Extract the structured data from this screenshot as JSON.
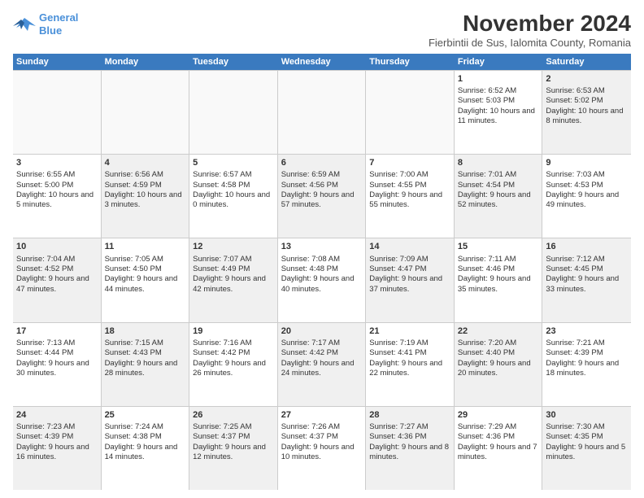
{
  "logo": {
    "line1": "General",
    "line2": "Blue"
  },
  "header": {
    "title": "November 2024",
    "subtitle": "Fierbintii de Sus, Ialomita County, Romania"
  },
  "weekdays": [
    "Sunday",
    "Monday",
    "Tuesday",
    "Wednesday",
    "Thursday",
    "Friday",
    "Saturday"
  ],
  "rows": [
    [
      {
        "day": "",
        "sunrise": "",
        "sunset": "",
        "daylight": "",
        "shaded": false,
        "empty": true
      },
      {
        "day": "",
        "sunrise": "",
        "sunset": "",
        "daylight": "",
        "shaded": false,
        "empty": true
      },
      {
        "day": "",
        "sunrise": "",
        "sunset": "",
        "daylight": "",
        "shaded": false,
        "empty": true
      },
      {
        "day": "",
        "sunrise": "",
        "sunset": "",
        "daylight": "",
        "shaded": false,
        "empty": true
      },
      {
        "day": "",
        "sunrise": "",
        "sunset": "",
        "daylight": "",
        "shaded": false,
        "empty": true
      },
      {
        "day": "1",
        "sunrise": "Sunrise: 6:52 AM",
        "sunset": "Sunset: 5:03 PM",
        "daylight": "Daylight: 10 hours and 11 minutes.",
        "shaded": false,
        "empty": false
      },
      {
        "day": "2",
        "sunrise": "Sunrise: 6:53 AM",
        "sunset": "Sunset: 5:02 PM",
        "daylight": "Daylight: 10 hours and 8 minutes.",
        "shaded": true,
        "empty": false
      }
    ],
    [
      {
        "day": "3",
        "sunrise": "Sunrise: 6:55 AM",
        "sunset": "Sunset: 5:00 PM",
        "daylight": "Daylight: 10 hours and 5 minutes.",
        "shaded": false,
        "empty": false
      },
      {
        "day": "4",
        "sunrise": "Sunrise: 6:56 AM",
        "sunset": "Sunset: 4:59 PM",
        "daylight": "Daylight: 10 hours and 3 minutes.",
        "shaded": true,
        "empty": false
      },
      {
        "day": "5",
        "sunrise": "Sunrise: 6:57 AM",
        "sunset": "Sunset: 4:58 PM",
        "daylight": "Daylight: 10 hours and 0 minutes.",
        "shaded": false,
        "empty": false
      },
      {
        "day": "6",
        "sunrise": "Sunrise: 6:59 AM",
        "sunset": "Sunset: 4:56 PM",
        "daylight": "Daylight: 9 hours and 57 minutes.",
        "shaded": true,
        "empty": false
      },
      {
        "day": "7",
        "sunrise": "Sunrise: 7:00 AM",
        "sunset": "Sunset: 4:55 PM",
        "daylight": "Daylight: 9 hours and 55 minutes.",
        "shaded": false,
        "empty": false
      },
      {
        "day": "8",
        "sunrise": "Sunrise: 7:01 AM",
        "sunset": "Sunset: 4:54 PM",
        "daylight": "Daylight: 9 hours and 52 minutes.",
        "shaded": true,
        "empty": false
      },
      {
        "day": "9",
        "sunrise": "Sunrise: 7:03 AM",
        "sunset": "Sunset: 4:53 PM",
        "daylight": "Daylight: 9 hours and 49 minutes.",
        "shaded": false,
        "empty": false
      }
    ],
    [
      {
        "day": "10",
        "sunrise": "Sunrise: 7:04 AM",
        "sunset": "Sunset: 4:52 PM",
        "daylight": "Daylight: 9 hours and 47 minutes.",
        "shaded": true,
        "empty": false
      },
      {
        "day": "11",
        "sunrise": "Sunrise: 7:05 AM",
        "sunset": "Sunset: 4:50 PM",
        "daylight": "Daylight: 9 hours and 44 minutes.",
        "shaded": false,
        "empty": false
      },
      {
        "day": "12",
        "sunrise": "Sunrise: 7:07 AM",
        "sunset": "Sunset: 4:49 PM",
        "daylight": "Daylight: 9 hours and 42 minutes.",
        "shaded": true,
        "empty": false
      },
      {
        "day": "13",
        "sunrise": "Sunrise: 7:08 AM",
        "sunset": "Sunset: 4:48 PM",
        "daylight": "Daylight: 9 hours and 40 minutes.",
        "shaded": false,
        "empty": false
      },
      {
        "day": "14",
        "sunrise": "Sunrise: 7:09 AM",
        "sunset": "Sunset: 4:47 PM",
        "daylight": "Daylight: 9 hours and 37 minutes.",
        "shaded": true,
        "empty": false
      },
      {
        "day": "15",
        "sunrise": "Sunrise: 7:11 AM",
        "sunset": "Sunset: 4:46 PM",
        "daylight": "Daylight: 9 hours and 35 minutes.",
        "shaded": false,
        "empty": false
      },
      {
        "day": "16",
        "sunrise": "Sunrise: 7:12 AM",
        "sunset": "Sunset: 4:45 PM",
        "daylight": "Daylight: 9 hours and 33 minutes.",
        "shaded": true,
        "empty": false
      }
    ],
    [
      {
        "day": "17",
        "sunrise": "Sunrise: 7:13 AM",
        "sunset": "Sunset: 4:44 PM",
        "daylight": "Daylight: 9 hours and 30 minutes.",
        "shaded": false,
        "empty": false
      },
      {
        "day": "18",
        "sunrise": "Sunrise: 7:15 AM",
        "sunset": "Sunset: 4:43 PM",
        "daylight": "Daylight: 9 hours and 28 minutes.",
        "shaded": true,
        "empty": false
      },
      {
        "day": "19",
        "sunrise": "Sunrise: 7:16 AM",
        "sunset": "Sunset: 4:42 PM",
        "daylight": "Daylight: 9 hours and 26 minutes.",
        "shaded": false,
        "empty": false
      },
      {
        "day": "20",
        "sunrise": "Sunrise: 7:17 AM",
        "sunset": "Sunset: 4:42 PM",
        "daylight": "Daylight: 9 hours and 24 minutes.",
        "shaded": true,
        "empty": false
      },
      {
        "day": "21",
        "sunrise": "Sunrise: 7:19 AM",
        "sunset": "Sunset: 4:41 PM",
        "daylight": "Daylight: 9 hours and 22 minutes.",
        "shaded": false,
        "empty": false
      },
      {
        "day": "22",
        "sunrise": "Sunrise: 7:20 AM",
        "sunset": "Sunset: 4:40 PM",
        "daylight": "Daylight: 9 hours and 20 minutes.",
        "shaded": true,
        "empty": false
      },
      {
        "day": "23",
        "sunrise": "Sunrise: 7:21 AM",
        "sunset": "Sunset: 4:39 PM",
        "daylight": "Daylight: 9 hours and 18 minutes.",
        "shaded": false,
        "empty": false
      }
    ],
    [
      {
        "day": "24",
        "sunrise": "Sunrise: 7:23 AM",
        "sunset": "Sunset: 4:39 PM",
        "daylight": "Daylight: 9 hours and 16 minutes.",
        "shaded": true,
        "empty": false
      },
      {
        "day": "25",
        "sunrise": "Sunrise: 7:24 AM",
        "sunset": "Sunset: 4:38 PM",
        "daylight": "Daylight: 9 hours and 14 minutes.",
        "shaded": false,
        "empty": false
      },
      {
        "day": "26",
        "sunrise": "Sunrise: 7:25 AM",
        "sunset": "Sunset: 4:37 PM",
        "daylight": "Daylight: 9 hours and 12 minutes.",
        "shaded": true,
        "empty": false
      },
      {
        "day": "27",
        "sunrise": "Sunrise: 7:26 AM",
        "sunset": "Sunset: 4:37 PM",
        "daylight": "Daylight: 9 hours and 10 minutes.",
        "shaded": false,
        "empty": false
      },
      {
        "day": "28",
        "sunrise": "Sunrise: 7:27 AM",
        "sunset": "Sunset: 4:36 PM",
        "daylight": "Daylight: 9 hours and 8 minutes.",
        "shaded": true,
        "empty": false
      },
      {
        "day": "29",
        "sunrise": "Sunrise: 7:29 AM",
        "sunset": "Sunset: 4:36 PM",
        "daylight": "Daylight: 9 hours and 7 minutes.",
        "shaded": false,
        "empty": false
      },
      {
        "day": "30",
        "sunrise": "Sunrise: 7:30 AM",
        "sunset": "Sunset: 4:35 PM",
        "daylight": "Daylight: 9 hours and 5 minutes.",
        "shaded": true,
        "empty": false
      }
    ]
  ]
}
